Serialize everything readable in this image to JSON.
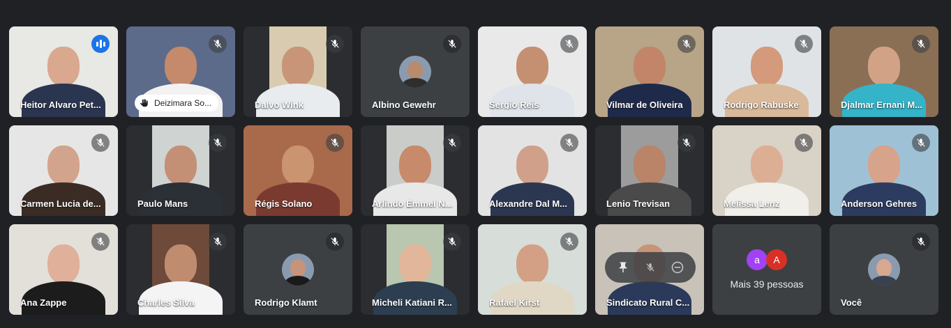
{
  "participants": [
    {
      "name": "Heitor Alvaro Pet...",
      "state": "speaking",
      "bg": "#e8e8e4",
      "skin": "#d9a88f",
      "shirt": "#2a3550"
    },
    {
      "name": "Deizimara So...",
      "state": "hand",
      "bg": "#5c6b8a",
      "skin": "#c48a6b",
      "shirt": "#f2f2f2"
    },
    {
      "name": "Dalvo Wink",
      "state": "muted",
      "bg": "#d8cbb0",
      "skin": "#c99578",
      "shirt": "#e8ecef",
      "narrow": true
    },
    {
      "name": "Albino Gewehr",
      "state": "avatar",
      "skin": "#b88a6e",
      "shirt": "#2e2e2e"
    },
    {
      "name": "Sergio Reis",
      "state": "muted",
      "bg": "#e9e9e9",
      "skin": "#c58f72",
      "shirt": "#dfe3ea"
    },
    {
      "name": "Vilmar de Oliveira",
      "state": "muted",
      "bg": "#b8a487",
      "skin": "#c2856a",
      "shirt": "#1f2a4a"
    },
    {
      "name": "Rodrigo Rabuske",
      "state": "muted",
      "bg": "#dfe3e6",
      "skin": "#d49a7b",
      "shirt": "#d9b99a"
    },
    {
      "name": "Djalmar Ernani M...",
      "state": "muted",
      "bg": "#8a6f55",
      "skin": "#d2a287",
      "shirt": "#35b3c9"
    },
    {
      "name": "Carmen Lucia de...",
      "state": "muted",
      "bg": "#e6e6e6",
      "skin": "#d3a48d",
      "shirt": "#3a2c25"
    },
    {
      "name": "Paulo Mans",
      "state": "muted",
      "bg": "#cfd3d1",
      "skin": "#c49075",
      "shirt": "#2b2f36",
      "narrow": true
    },
    {
      "name": "Régis Solano",
      "state": "muted",
      "bg": "#a86a4a",
      "skin": "#c9946f",
      "shirt": "#7a3a30"
    },
    {
      "name": "Arlindo Emmel N...",
      "state": "muted",
      "bg": "#c9ccc9",
      "skin": "#c78a6a",
      "shirt": "#e8e8e8",
      "narrow": true
    },
    {
      "name": "Alexandre Dal M...",
      "state": "muted",
      "bg": "#e3e3e3",
      "skin": "#d0a08a",
      "shirt": "#2b3750"
    },
    {
      "name": "Lenio Trevisan",
      "state": "muted",
      "bg": "#9c9c9c",
      "skin": "#b98468",
      "shirt": "#4a4a4a",
      "narrow": true
    },
    {
      "name": "Melissa Lenz",
      "state": "muted",
      "bg": "#d9d2c6",
      "skin": "#dcae94",
      "shirt": "#f0efe9"
    },
    {
      "name": "Anderson Gehres",
      "state": "muted",
      "bg": "#9fc1d6",
      "skin": "#d7a38a",
      "shirt": "#2c3c60"
    },
    {
      "name": "Ana Zappe",
      "state": "muted",
      "bg": "#e3e0da",
      "skin": "#e0b09a",
      "shirt": "#1c1c1c"
    },
    {
      "name": "Charles Silva",
      "state": "muted",
      "bg": "#6e4a3a",
      "skin": "#c08c70",
      "shirt": "#f4f4f4",
      "narrow": true
    },
    {
      "name": "Rodrigo Klamt",
      "state": "avatar",
      "skin": "#c7937a",
      "shirt": "#1a1a1a"
    },
    {
      "name": "Micheli Katiani R...",
      "state": "muted",
      "bg": "#b9c6b0",
      "skin": "#e2b69a",
      "shirt": "#2c3e50",
      "narrow": true
    },
    {
      "name": "Rafael Kirst",
      "state": "muted",
      "bg": "#d7ddd8",
      "skin": "#d3a085",
      "shirt": "#e0d8c5"
    },
    {
      "name": "Sindicato Rural C...",
      "state": "hover",
      "bg": "#c8c2b8",
      "skin": "#c79478",
      "shirt": "#2b3a5a"
    },
    {
      "name": "",
      "state": "more"
    },
    {
      "name": "Você",
      "state": "self",
      "skin": "#d8a890",
      "shirt": "#38414d"
    }
  ],
  "more_tile": {
    "label": "Mais 39 pessoas",
    "avatars": [
      {
        "letter": "a",
        "color": "#a142f4"
      },
      {
        "letter": "A",
        "color": "#d93025"
      }
    ]
  },
  "colors": {
    "background": "#202124",
    "tile": "#3c4043",
    "speaking_outline": "#8ab4f8",
    "speaking_badge": "#1a73e8"
  },
  "icons": {
    "muted": "mic-off-icon",
    "speaking": "audio-level-icon",
    "hand": "raised-hand-icon",
    "pin": "pin-icon",
    "remove": "remove-icon"
  }
}
